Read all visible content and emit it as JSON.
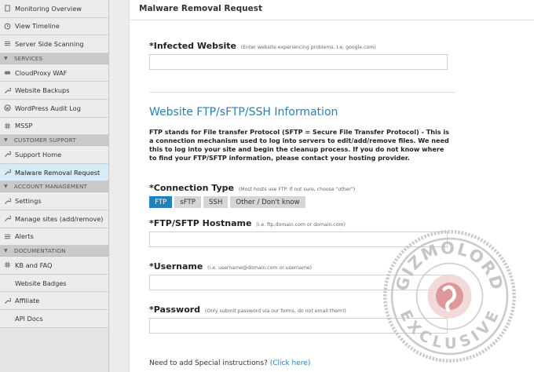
{
  "sidebar": {
    "items": [
      {
        "label": "Monitoring Overview",
        "icon": "document-icon"
      },
      {
        "label": "View Timeline",
        "icon": "clock-icon"
      },
      {
        "label": "Server Side Scanning",
        "icon": "list-icon"
      }
    ],
    "services_title": "SERVICES",
    "services": [
      {
        "label": "CloudProxy WAF",
        "icon": "cloud-icon"
      },
      {
        "label": "Website Backups",
        "icon": "wrench-icon"
      },
      {
        "label": "WordPress Audit Log",
        "icon": "wordpress-icon"
      },
      {
        "label": "MSSP",
        "icon": "hash-icon"
      }
    ],
    "support_title": "CUSTOMER SUPPORT",
    "support": [
      {
        "label": "Support Home",
        "icon": "wrench-icon"
      },
      {
        "label": "Malware Removal Request",
        "icon": "wrench-icon"
      }
    ],
    "account_title": "ACCOUNT MANAGEMENT",
    "account": [
      {
        "label": "Settings",
        "icon": "wrench-icon"
      },
      {
        "label": "Manage sites (add/remove)",
        "icon": "wrench-icon"
      },
      {
        "label": "Alerts",
        "icon": "list-icon"
      }
    ],
    "docs_title": "DOCUMENTATION",
    "docs": [
      {
        "label": "KB and FAQ",
        "icon": "hash-icon"
      },
      {
        "label": "Website Badges",
        "icon": ""
      },
      {
        "label": "Affiliate",
        "icon": "wrench-icon"
      },
      {
        "label": "API Docs",
        "icon": ""
      }
    ]
  },
  "main": {
    "title": "Malware Removal Request",
    "infected_label": "*Infected Website",
    "infected_hint": "(Enter website experiencing problems. I.e, google.com)",
    "ftp_heading": "Website FTP/sFTP/SSH Information",
    "ftp_desc": "FTP stands for File transfer Protocol (SFTP = Secure File Transfer Protocol) - This is a connection mechanism used to log into servers to edit/add/remove files. We need this to log into your site and begin the cleanup process. If you do not know where to find your FTP/SFTP information, please contact your hosting provider.",
    "conn_label": "*Connection Type",
    "conn_hint": "(Most hosts use FTP. If not sure, choose \"other\")",
    "conn_options": [
      "FTP",
      "sFTP",
      "SSH",
      "Other / Don't know"
    ],
    "conn_selected": "FTP",
    "host_label": "*FTP/SFTP Hostname",
    "host_hint": "(i.e. ftp.domain.com or domain.com)",
    "user_label": "*Username",
    "user_hint": "(i.e. username@domain.com or username)",
    "pass_label": "*Password",
    "pass_hint": "(Only submit password via our forms, do not email them!)",
    "special_text": "Need to add Special instructions?",
    "special_link": "(Click here)"
  },
  "watermark": {
    "top_text": "GIZMOLORD",
    "bottom_text": "EXCLUSIVE"
  },
  "colors": {
    "accent": "#2a7fb4",
    "active_button": "#2281b6",
    "active_nav": "#d6ecf6",
    "stamp": "#c2c2c2"
  }
}
